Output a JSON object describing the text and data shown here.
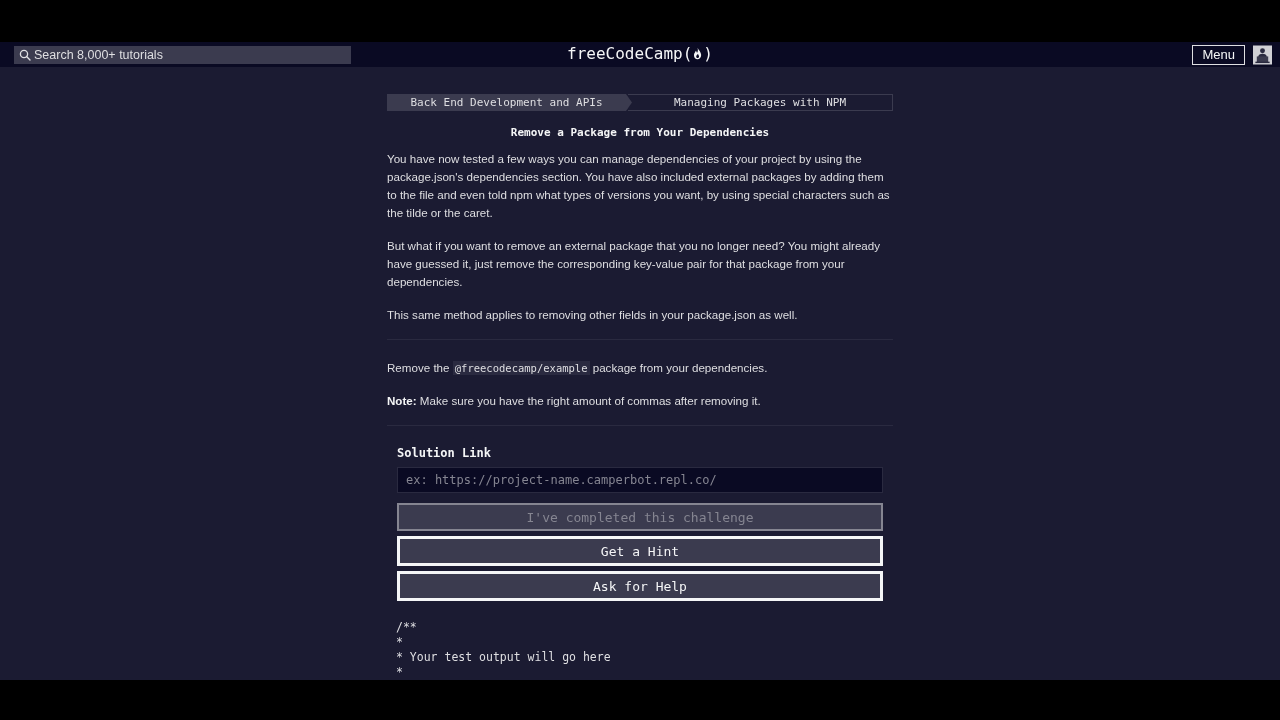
{
  "nav": {
    "search": {
      "placeholder": "Search 8,000+ tutorials"
    },
    "logo": {
      "text": "freeCodeCamp",
      "open": "(",
      "close": ")"
    },
    "menu_button": "Menu"
  },
  "breadcrumb": [
    {
      "label": "Back End Development and APIs",
      "kind": "superblock"
    },
    {
      "label": "Managing Packages with NPM",
      "kind": "block"
    }
  ],
  "challenge": {
    "title": "Remove a Package from Your Dependencies",
    "description": [
      "You have now tested a few ways you can manage dependencies of your project by using the package.json's dependencies section. You have also included external packages by adding them to the file and even told npm what types of versions you want, by using special characters such as the tilde or the caret.",
      "But what if you want to remove an external package that you no longer need? You might already have guessed it, just remove the corresponding key-value pair for that package from your dependencies.",
      "This same method applies to removing other fields in your package.json as well."
    ],
    "instructions": [
      {
        "before": "Remove the ",
        "code": "@freecodecamp/example",
        "after": " package from your dependencies."
      },
      {
        "before": "**Note:** Make sure you have the right amount of commas after removing it."
      }
    ]
  },
  "form": {
    "label": "Solution Link",
    "placeholder": "ex: https://project-name.camperbot.repl.co/",
    "buttons": [
      {
        "label": "I've completed this challenge",
        "disabled": true
      },
      {
        "label": "Get a Hint",
        "disabled": false
      },
      {
        "label": "Ask for Help",
        "disabled": false
      }
    ]
  },
  "output": {
    "lines": [
      "/**",
      "*",
      "* Your test output will go here",
      "*"
    ]
  }
}
